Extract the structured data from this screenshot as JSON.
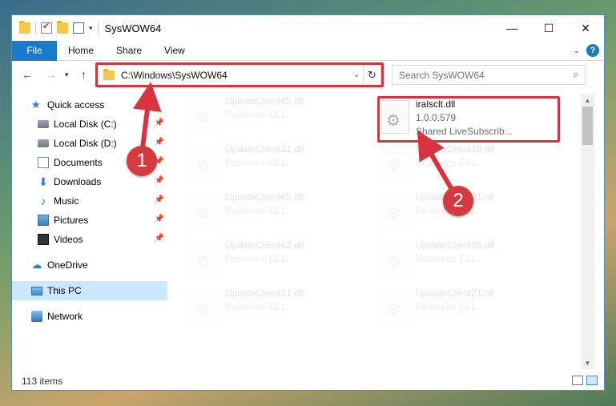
{
  "window": {
    "title": "SysWOW64"
  },
  "ribbon": {
    "tabs": [
      "File",
      "Home",
      "Share",
      "View"
    ],
    "help": "?"
  },
  "address": {
    "path": "C:\\Windows\\SysWOW64"
  },
  "search": {
    "placeholder": "Search SysWOW64"
  },
  "sidebar": {
    "quick_access": "Quick access",
    "items": [
      {
        "label": "Local Disk (C:)",
        "icon": "drive-icon"
      },
      {
        "label": "Local Disk (D:)",
        "icon": "drive-icon"
      },
      {
        "label": "Documents",
        "icon": "documents-icon"
      },
      {
        "label": "Downloads",
        "icon": "downloads-icon"
      },
      {
        "label": "Music",
        "icon": "music-icon"
      },
      {
        "label": "Pictures",
        "icon": "pictures-icon"
      },
      {
        "label": "Videos",
        "icon": "videos-icon"
      }
    ],
    "onedrive": "OneDrive",
    "this_pc": "This PC",
    "network": "Network"
  },
  "files": {
    "left": [
      {
        "name": "UpdateClient65.dll",
        "type": "Resource DLL"
      },
      {
        "name": "UpdateClient21.dll",
        "type": "Resource DLL"
      },
      {
        "name": "UpdateClient65.dll",
        "type": "Resource DLL"
      },
      {
        "name": "UpdateClient42.dll",
        "type": "Resource DLL"
      },
      {
        "name": "UpdateClient21.dll",
        "type": "Resource DLL"
      }
    ],
    "right": [
      {
        "name": "UpdateClient19.dll",
        "type": "Resource DLL"
      },
      {
        "name": "UpdateClient21.dll",
        "type": "Resource DLL"
      },
      {
        "name": "UpdateClient65.dll",
        "type": "Resource DLL"
      },
      {
        "name": "UpdateClient21.dll",
        "type": "Resource DLL"
      }
    ],
    "highlighted": {
      "name": "iralsclt.dll",
      "version": "1.0.0.579",
      "description": "Shared LiveSubscrib..."
    }
  },
  "status": {
    "count": "113 items"
  },
  "annotations": {
    "step1": "1",
    "step2": "2",
    "color": "#d9333f"
  }
}
